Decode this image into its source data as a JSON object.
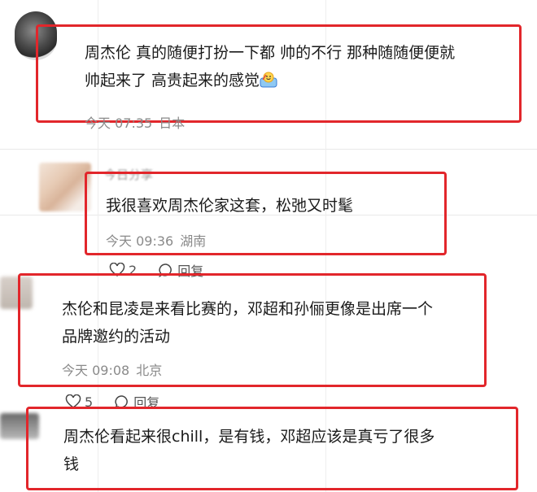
{
  "comments": [
    {
      "text_line1": "周杰伦 真的随便打扮一下都 帅的不行 那种随随便便就",
      "text_line2": "帅起来了 高贵起来的感觉",
      "time": "今天 07:35",
      "location": "日本",
      "emoji": "smile-emoji"
    },
    {
      "username": "今日分享",
      "text": "我很喜欢周杰伦家这套，松弛又时髦",
      "time": "今天 09:36",
      "location": "湖南",
      "likes": "2",
      "reply_label": "回复"
    },
    {
      "text_line1": "杰伦和昆凌是来看比赛的，邓超和孙俪更像是出席一个",
      "text_line2": "品牌邀约的活动",
      "time": "今天 09:08",
      "location": "北京",
      "likes": "5",
      "reply_label": "回复"
    },
    {
      "text_line1": "周杰伦看起来很chill，是有钱，邓超应该是真亏了很多",
      "text_line2": "钱"
    }
  ],
  "colors": {
    "highlight": "#e2262b",
    "meta": "#8a8a8a"
  }
}
